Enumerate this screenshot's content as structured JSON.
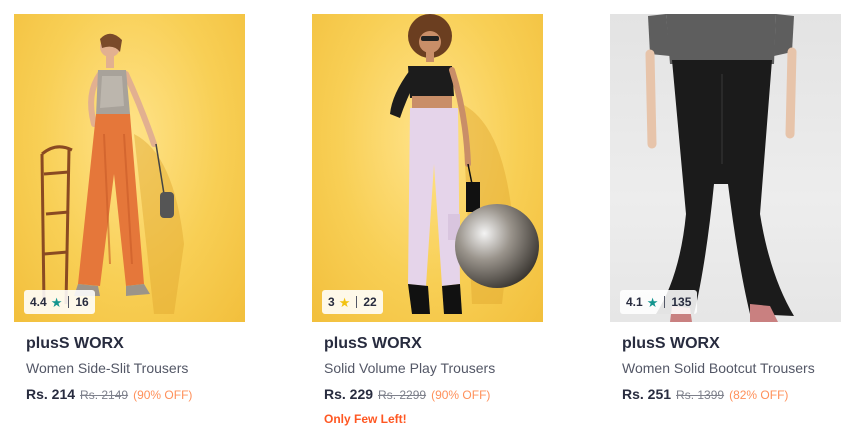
{
  "colors": {
    "brand_text": "#282c3f",
    "subtitle_text": "#535766",
    "mrp_text": "#7e818c",
    "discount": "#ff905a",
    "stock_alert": "#ff5722",
    "star_green": "#14958f",
    "star_yellow": "#f2c210"
  },
  "products": [
    {
      "image_icon": "model-orange-trousers-image",
      "rating": "4.4",
      "star_icon": "star-icon",
      "star_color": "#14958f",
      "rating_count": "16",
      "brand": "plusS WORX",
      "title": "Women Side-Slit Trousers",
      "price": "Rs. 214",
      "mrp": "Rs. 2149",
      "discount": "(90% OFF)",
      "stock_note": ""
    },
    {
      "image_icon": "model-lilac-trousers-image",
      "rating": "3",
      "star_icon": "star-icon",
      "star_color": "#f2c210",
      "rating_count": "22",
      "brand": "plusS WORX",
      "title": "Solid Volume Play Trousers",
      "price": "Rs. 229",
      "mrp": "Rs. 2299",
      "discount": "(90% OFF)",
      "stock_note": "Only Few Left!"
    },
    {
      "image_icon": "model-black-bootcut-trousers-image",
      "rating": "4.1",
      "star_icon": "star-icon",
      "star_color": "#14958f",
      "rating_count": "135",
      "brand": "plusS WORX",
      "title": "Women Solid Bootcut Trousers",
      "price": "Rs. 251",
      "mrp": "Rs. 1399",
      "discount": "(82% OFF)",
      "stock_note": ""
    }
  ]
}
